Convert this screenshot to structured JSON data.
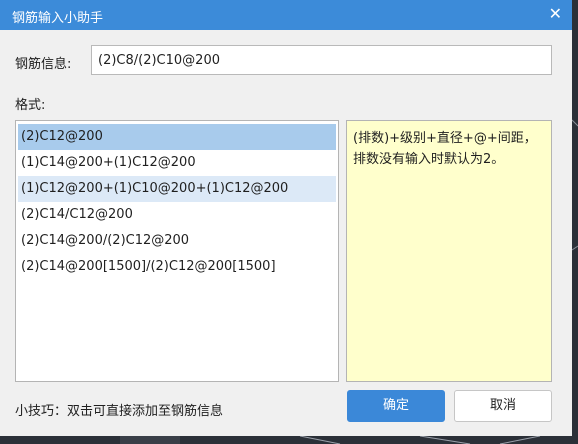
{
  "window": {
    "title": "钢筋输入小助手",
    "close_glyph": "✕"
  },
  "info": {
    "label": "钢筋信息:",
    "value": "(2)C8/(2)C10@200"
  },
  "format": {
    "label": "格式:",
    "items": [
      "(2)C12@200",
      "(1)C14@200+(1)C12@200",
      "(1)C12@200+(1)C10@200+(1)C12@200",
      "(2)C14/C12@200",
      "(2)C14@200/(2)C12@200",
      "(2)C14@200[1500]/(2)C12@200[1500]"
    ],
    "selected_index": 0,
    "hovered_index": 2
  },
  "hint": "(排数)+级别+直径+@+间距，排数没有输入时默认为2。",
  "tip": "小技巧：双击可直接添加至钢筋信息",
  "buttons": {
    "ok": "确定",
    "cancel": "取消"
  },
  "colors": {
    "title_bar": "#3c8bd9",
    "selected_row": "#a8cbec",
    "hover_row": "#dce9f7",
    "hint_background": "#ffffcc",
    "primary_button": "#3b88d8"
  },
  "icons": {
    "close": "close-icon"
  }
}
